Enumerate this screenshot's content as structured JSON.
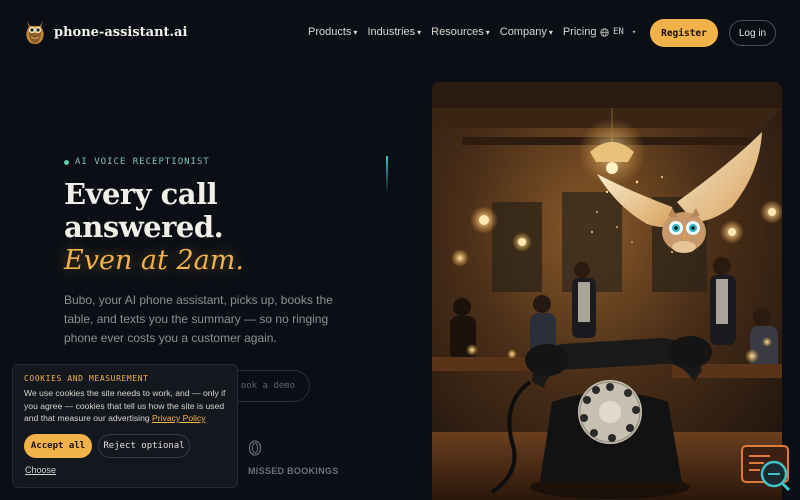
{
  "brand": {
    "name": "phone-assistant.ai"
  },
  "nav": {
    "items": [
      {
        "label": "Products",
        "caret": "▾"
      },
      {
        "label": "Industries",
        "caret": "▾"
      },
      {
        "label": "Resources",
        "caret": "▾"
      },
      {
        "label": "Company",
        "caret": "▾"
      },
      {
        "label": "Pricing",
        "caret": ""
      }
    ],
    "language": "EN",
    "register_label": "Register",
    "login_label": "Log in"
  },
  "hero": {
    "eyebrow": "AI VOICE RECEPTIONIST",
    "headline_line1": "Every call",
    "headline_line2": "answered.",
    "headline_accent": "Even at 2am.",
    "subcopy": "Bubo, your AI phone assistant, picks up, books the table, and texts you the summary — so no ringing phone ever costs you a customer again.",
    "demo_label": "ook a demo",
    "stat_label": "MISSED BOOKINGS"
  },
  "cookie": {
    "title": "COOKIES AND MEASUREMENT",
    "text": "We use cookies the site needs to work, and — only if you agree — cookies that tell us how the site is used and that measure our advertising",
    "policy_link": "Privacy Policy",
    "accept_label": "Accept all",
    "reject_label": "Reject optional",
    "choose_label": "Choose"
  },
  "icons": {
    "logo": "owl-logo-icon",
    "language": "globe-icon",
    "stat": "coin-icon",
    "widget": "chat-search-icon"
  },
  "colors": {
    "background": "#0b0f15",
    "accent": "#f2b24a",
    "eyebrow": "#7fc2b4"
  }
}
